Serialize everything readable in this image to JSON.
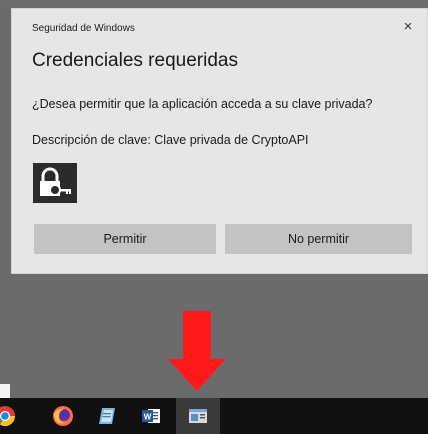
{
  "dialog": {
    "header": "Seguridad de Windows",
    "title": "Credenciales requeridas",
    "question": "¿Desea permitir que la aplicación acceda a su clave privada?",
    "description": "Descripción de clave: Clave privada de CryptoAPI",
    "allow_label": "Permitir",
    "deny_label": "No permitir",
    "close_glyph": "×"
  },
  "taskbar": {
    "icons": [
      "chrome-icon",
      "firefox-icon",
      "notepad-icon",
      "word-icon",
      "app-window-icon"
    ]
  },
  "colors": {
    "dialog_bg": "#e6e6e6",
    "button_bg": "#c3c3c3",
    "desktop_bg": "#6b6b6b",
    "taskbar_bg": "#111111",
    "arrow": "#ff1a1a"
  }
}
